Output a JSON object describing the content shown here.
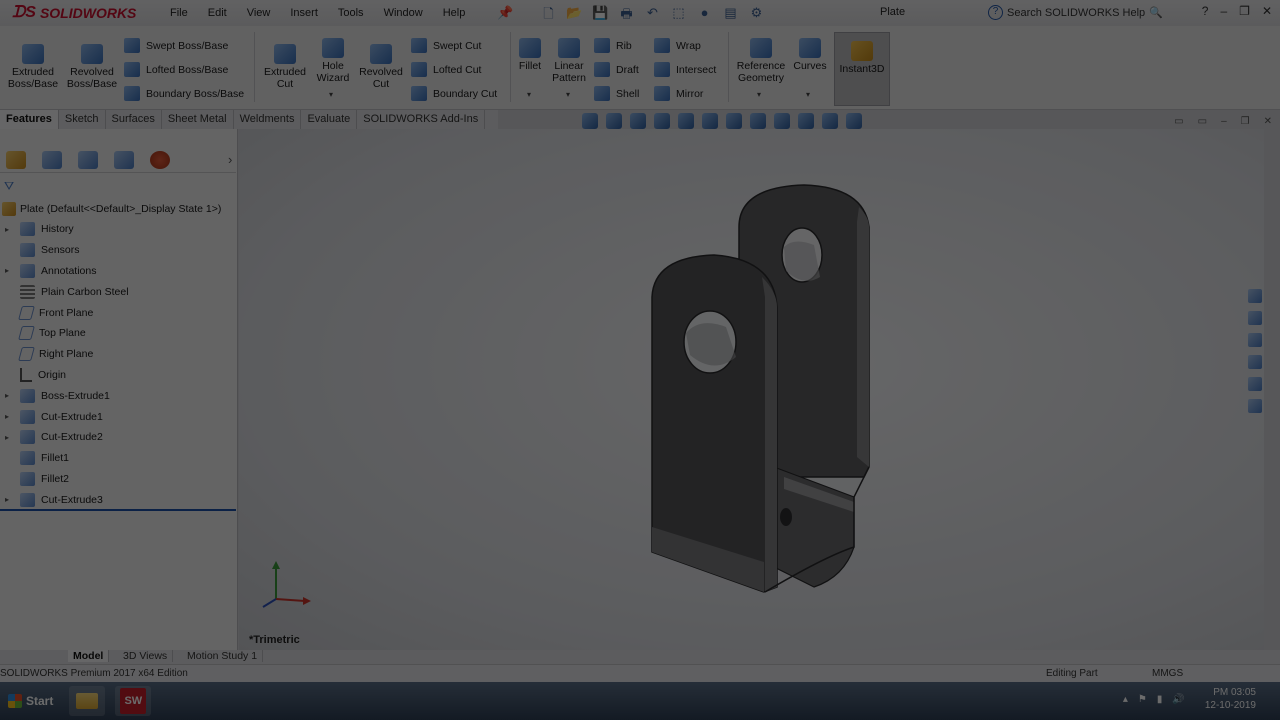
{
  "app": {
    "brand": "SOLIDWORKS",
    "document_title": "Plate",
    "search_placeholder": "Search SOLIDWORKS Help"
  },
  "menu": [
    "File",
    "Edit",
    "View",
    "Insert",
    "Tools",
    "Window",
    "Help"
  ],
  "commands": {
    "extruded_boss": "Extruded Boss/Base",
    "revolved_boss": "Revolved Boss/Base",
    "swept_boss": "Swept Boss/Base",
    "lofted_boss": "Lofted Boss/Base",
    "boundary_boss": "Boundary Boss/Base",
    "extruded_cut": "Extruded Cut",
    "hole_wizard": "Hole Wizard",
    "revolved_cut": "Revolved Cut",
    "swept_cut": "Swept Cut",
    "lofted_cut": "Lofted Cut",
    "boundary_cut": "Boundary Cut",
    "fillet": "Fillet",
    "linear_pattern": "Linear Pattern",
    "rib": "Rib",
    "draft": "Draft",
    "shell": "Shell",
    "wrap": "Wrap",
    "intersect": "Intersect",
    "mirror": "Mirror",
    "reference_geometry": "Reference Geometry",
    "curves": "Curves",
    "instant3d": "Instant3D"
  },
  "tabs": [
    "Features",
    "Sketch",
    "Surfaces",
    "Sheet Metal",
    "Weldments",
    "Evaluate",
    "SOLIDWORKS Add-Ins"
  ],
  "tree": {
    "root": "Plate  (Default<<Default>_Display State 1>)",
    "items": [
      "History",
      "Sensors",
      "Annotations",
      "Plain Carbon Steel",
      "Front Plane",
      "Top Plane",
      "Right Plane",
      "Origin",
      "Boss-Extrude1",
      "Cut-Extrude1",
      "Cut-Extrude2",
      "Fillet1",
      "Fillet2",
      "Cut-Extrude3"
    ]
  },
  "viewport": {
    "view_name": "*Trimetric"
  },
  "bottom_tabs": [
    "Model",
    "3D Views",
    "Motion Study 1"
  ],
  "status": {
    "edition": "SOLIDWORKS Premium 2017 x64 Edition",
    "mode": "Editing Part",
    "units": "MMGS"
  },
  "taskbar": {
    "start": "Start",
    "sw_label": "SW",
    "time": "PM 03:05",
    "date": "12-10-2019"
  },
  "colors": {
    "brand_red": "#c8102e",
    "rollback_bar": "#1c4fa8",
    "part_body": "#545457"
  }
}
